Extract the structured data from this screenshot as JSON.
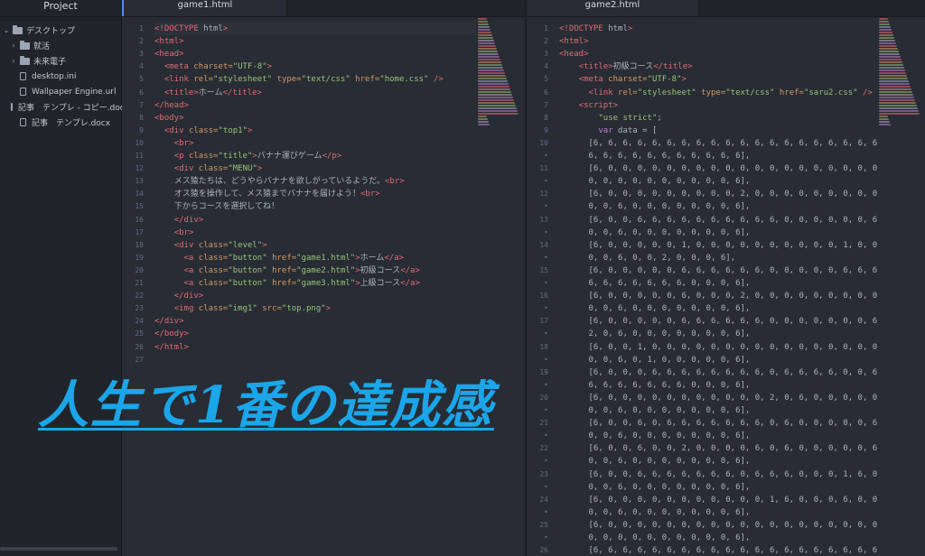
{
  "sidebar": {
    "header": "Project",
    "items": [
      {
        "label": "デスクトップ",
        "type": "folder",
        "expanded": true,
        "depth": 0
      },
      {
        "label": "就活",
        "type": "folder",
        "expanded": false,
        "depth": 1
      },
      {
        "label": "未来電子",
        "type": "folder",
        "expanded": false,
        "depth": 1
      },
      {
        "label": "desktop.ini",
        "type": "file",
        "depth": 1
      },
      {
        "label": "Wallpaper Engine.url",
        "type": "file",
        "depth": 1
      },
      {
        "label": "記事　テンプレ - コピー.docx",
        "type": "file",
        "depth": 1
      },
      {
        "label": "記事　テンプレ.docx",
        "type": "file",
        "depth": 1
      }
    ]
  },
  "editor1": {
    "tab": "game1.html",
    "line_numbers": [
      "1",
      "2",
      "3",
      "4",
      "5",
      "6",
      "7",
      "8",
      "9",
      "10",
      "11",
      "12",
      "13",
      "14",
      "15",
      "16",
      "17",
      "18",
      "19",
      "20",
      "21",
      "22",
      "23",
      "24",
      "25",
      "26",
      "27"
    ],
    "lines": [
      "<!DOCTYPE html>",
      "<html>",
      "<head>",
      "  <meta charset=\"UTF-8\">",
      "  <link rel=\"stylesheet\" type=\"text/css\" href=\"home.css\" />",
      "  <title>ホーム</title>",
      "</head>",
      "<body>",
      "  <div class=\"top1\">",
      "    <br>",
      "    <p class=\"title\">バナナ運びゲーム</p>",
      "    <div class=\"MENU\">",
      "    メス猿たちは、どうやらバナナを欲しがっているようだ。<br>",
      "    オス猿を操作して、メス猿までバナナを届けよう！<br>",
      "    下からコースを選択してね！",
      "    </div>",
      "    <br>",
      "    <div class=\"level\">",
      "      <a class=\"button\" href=\"game1.html\">ホーム</a>",
      "      <a class=\"button\" href=\"game2.html\">初級コース</a>",
      "      <a class=\"button\" href=\"game3.html\">上級コース</a>",
      "    </div>",
      "    <img class=\"img1\" src=\"top.png\">",
      "</div>",
      "</body>",
      "</html>",
      ""
    ]
  },
  "editor2": {
    "tab": "game2.html",
    "line_numbers": [
      "1",
      "2",
      "3",
      "4",
      "5",
      "6",
      "7",
      "8",
      "9",
      "10",
      "•",
      "11",
      "•",
      "12",
      "•",
      "13",
      "•",
      "14",
      "•",
      "15",
      "•",
      "16",
      "•",
      "17",
      "•",
      "18",
      "•",
      "19",
      "•",
      "20",
      "•",
      "21",
      "•",
      "22",
      "•",
      "23",
      "•",
      "24",
      "•",
      "25",
      "•",
      "26"
    ],
    "lines": [
      "<!DOCTYPE html>",
      "<html>",
      "<head>",
      "    <title>初級コース</title>",
      "    <meta charset=\"UTF-8\">",
      "      <link rel=\"stylesheet\" type=\"text/css\" href=\"saru2.css\" />",
      "    <script>",
      "        \"use strict\";",
      "        var data = [",
      "      [6, 6, 6, 6, 6, 6, 6, 6, 6, 6, 6, 6, 6, 6, 6, 6, 6, 6, 6, 6, 6,",
      "      6, 6, 6, 6, 6, 6, 6, 6, 6, 6, 6],",
      "      [6, 0, 0, 0, 0, 0, 0, 0, 0, 0, 0, 0, 0, 0, 0, 0, 0, 0, 0, 0, 0,",
      "      0, 0, 0, 0, 0, 0, 0, 0, 0, 0, 6],",
      "      [6, 0, 0, 0, 0, 0, 0, 0, 0, 0, 2, 0, 0, 0, 0, 0, 0, 0, 0, 0, 0,",
      "      0, 0, 6, 0, 0, 0, 0, 0, 0, 0, 6],",
      "      [6, 0, 0, 6, 6, 6, 6, 6, 6, 6, 6, 6, 6, 0, 0, 0, 0, 0, 0, 6, 0,",
      "      0, 0, 6, 0, 0, 0, 0, 0, 0, 0, 6],",
      "      [6, 0, 0, 0, 0, 0, 1, 0, 0, 0, 0, 0, 0, 0, 0, 0, 0, 1, 0, 0, 6,",
      "      0, 0, 6, 0, 0, 2, 0, 0, 0, 6],",
      "      [6, 0, 0, 0, 0, 0, 6, 6, 6, 6, 6, 6, 0, 0, 0, 0, 0, 6, 6, 6, 6,",
      "      6, 6, 6, 6, 6, 6, 6, 0, 0, 0, 6],",
      "      [6, 0, 0, 0, 0, 0, 6, 0, 0, 0, 2, 0, 0, 0, 0, 0, 0, 0, 0, 0, 0,",
      "      0, 0, 6, 0, 0, 0, 0, 0, 0, 0, 6],",
      "      [6, 0, 0, 0, 0, 0, 6, 6, 6, 6, 6, 6, 0, 0, 0, 0, 0, 0, 0, 6, 0,",
      "      2, 0, 6, 0, 0, 0, 0, 0, 0, 0, 6],",
      "      [6, 0, 0, 1, 0, 0, 0, 0, 0, 0, 0, 0, 0, 0, 0, 0, 0, 0, 0, 0, 0,",
      "      0, 0, 6, 0, 1, 0, 0, 0, 0, 0, 6],",
      "      [6, 0, 0, 0, 6, 6, 6, 6, 6, 6, 6, 6, 0, 6, 6, 6, 6, 0, 0, 6, 6,",
      "      6, 6, 6, 6, 6, 6, 6, 0, 0, 0, 6],",
      "      [6, 0, 0, 0, 0, 0, 0, 0, 0, 0, 0, 0, 2, 0, 6, 0, 0, 0, 0, 0, 0,",
      "      0, 0, 6, 0, 0, 0, 0, 0, 0, 0, 6],",
      "      [6, 0, 0, 6, 0, 6, 6, 6, 6, 6, 6, 6, 0, 6, 0, 0, 0, 0, 0, 6, 0,",
      "      0, 0, 6, 0, 0, 0, 0, 0, 0, 0, 6],",
      "      [6, 0, 0, 6, 0, 0, 2, 0, 0, 0, 0, 6, 0, 6, 0, 0, 0, 0, 0, 6, 0,",
      "      0, 0, 6, 0, 0, 0, 0, 0, 0, 0, 6],",
      "      [6, 0, 0, 6, 6, 6, 6, 6, 6, 6, 0, 6, 6, 6, 0, 0, 0, 1, 6, 0, 0,",
      "      0, 0, 6, 0, 0, 0, 0, 0, 0, 0, 6],",
      "      [6, 0, 0, 0, 0, 0, 0, 0, 0, 0, 0, 0, 1, 6, 0, 0, 0, 6, 0, 0, 0,",
      "      0, 0, 6, 0, 0, 0, 0, 0, 0, 0, 6],",
      "      [6, 0, 0, 0, 0, 0, 0, 0, 0, 0, 0, 0, 0, 0, 0, 0, 0, 0, 0, 0, 0,",
      "      0, 0, 0, 0, 0, 0, 0, 0, 0, 0, 6],",
      "      [6, 6, 6, 6, 6, 6, 6, 6, 6, 6, 6, 6, 6, 6, 6, 6, 6, 6, 6, 6, 6,"
    ]
  },
  "overlay_text": "人生で1番の達成感",
  "colors": {
    "accent": "#1aa6e8",
    "tag": "#e06c75",
    "attr": "#d19a66",
    "string": "#98c379",
    "keyword": "#c678dd",
    "editor_bg": "#282c34",
    "sidebar_bg": "#21252b"
  }
}
